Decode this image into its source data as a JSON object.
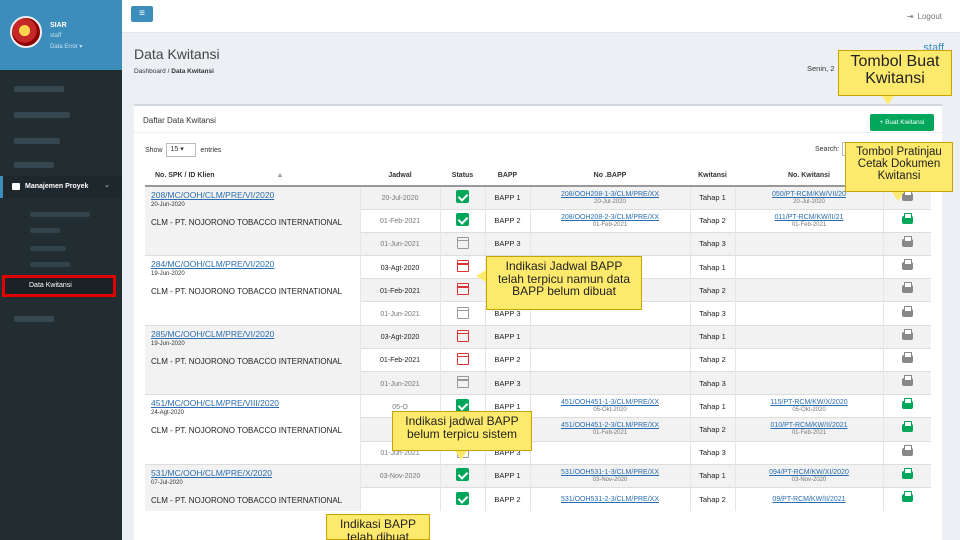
{
  "brand": {
    "name": "SIAR",
    "role": "staff",
    "menu": "Data Error ▾"
  },
  "sidebar": {
    "project_menu": "Manajemen Proyek",
    "active_item": "Data Kwitansi"
  },
  "topbar": {
    "menu_icon": "≡",
    "logout_icon": "⇥",
    "logout": "Logout"
  },
  "header": {
    "title": "Data Kwitansi",
    "breadcrumb_home": "Dashboard",
    "breadcrumb_sep": "/",
    "breadcrumb_current": "Data Kwitansi",
    "user": "staff",
    "date": "Senin, 2"
  },
  "box": {
    "title": "Daftar Data Kwitansi",
    "create_button": "+ Buat Kwitansi",
    "show_label": "Show",
    "show_value": "15 ▾",
    "entries_label": "entries",
    "search_label": "Search:"
  },
  "table": {
    "headers": [
      "No. SPK / ID Klien",
      "Jadwal",
      "Status",
      "BAPP",
      "No .BAPP",
      "Kwitansi",
      "No. Kwitansi",
      ""
    ],
    "sort_icon": "▲",
    "groups": [
      {
        "spk": "208/MC/OOH/CLM/PRE/VI/2020",
        "spk_date": "20-Jun-2020",
        "klien": "CLM - PT. NOJORONO TOBACCO INTERNATIONAL",
        "rows": [
          {
            "jadwal": "20-Jul-2020",
            "status": "ok",
            "bapp": "BAPP 1",
            "no_bapp": "208/OOH208-1-3/CLM/PRE/XX",
            "bapp_date": "20-Jul-2020",
            "kwitansi": "Tahap 1",
            "no_kw": "050/PT-RCM/KW/VII/20",
            "kw_date": "20-Jul-2020",
            "print": "grey"
          },
          {
            "jadwal": "01-Feb-2021",
            "status": "ok",
            "bapp": "BAPP 2",
            "no_bapp": "208/OOH208-2-3/CLM/PRE/XX",
            "bapp_date": "01-Feb-2021",
            "kwitansi": "Tahap 2",
            "no_kw": "011/PT-RCM/KW/II/21",
            "kw_date": "01-Feb-2021",
            "print": "green"
          },
          {
            "jadwal": "01-Jun-2021",
            "status": "cal-grey",
            "bapp": "BAPP 3",
            "no_bapp": "",
            "bapp_date": "",
            "kwitansi": "Tahap 3",
            "no_kw": "",
            "kw_date": "",
            "print": "grey"
          }
        ]
      },
      {
        "spk": "284/MC/OOH/CLM/PRE/VI/2020",
        "spk_date": "19-Jun-2020",
        "klien": "CLM - PT. NOJORONO TOBACCO INTERNATIONAL",
        "rows": [
          {
            "jadwal": "03-Agt-2020",
            "status": "cal-red",
            "bapp": "BAPP 1",
            "no_bapp": "",
            "bapp_date": "",
            "kwitansi": "Tahap 1",
            "no_kw": "",
            "kw_date": "",
            "print": "grey"
          },
          {
            "jadwal": "01-Feb-2021",
            "status": "cal-red",
            "bapp": "BAPP 2",
            "no_bapp": "",
            "bapp_date": "",
            "kwitansi": "Tahap 2",
            "no_kw": "",
            "kw_date": "",
            "print": "grey"
          },
          {
            "jadwal": "01-Jun-2021",
            "status": "cal-grey",
            "bapp": "BAPP 3",
            "no_bapp": "",
            "bapp_date": "",
            "kwitansi": "Tahap 3",
            "no_kw": "",
            "kw_date": "",
            "print": "grey"
          }
        ]
      },
      {
        "spk": "285/MC/OOH/CLM/PRE/VI/2020",
        "spk_date": "19-Jun-2020",
        "klien": "CLM - PT. NOJORONO TOBACCO INTERNATIONAL",
        "rows": [
          {
            "jadwal": "03-Agt-2020",
            "status": "cal-red",
            "bapp": "BAPP 1",
            "no_bapp": "",
            "bapp_date": "",
            "kwitansi": "Tahap 1",
            "no_kw": "",
            "kw_date": "",
            "print": "grey"
          },
          {
            "jadwal": "01-Feb-2021",
            "status": "cal-red",
            "bapp": "BAPP 2",
            "no_bapp": "",
            "bapp_date": "",
            "kwitansi": "Tahap 2",
            "no_kw": "",
            "kw_date": "",
            "print": "grey"
          },
          {
            "jadwal": "01-Jun-2021",
            "status": "cal-grey",
            "bapp": "BAPP 3",
            "no_bapp": "",
            "bapp_date": "",
            "kwitansi": "Tahap 3",
            "no_kw": "",
            "kw_date": "",
            "print": "grey"
          }
        ]
      },
      {
        "spk": "451/MC/OOH/CLM/PRE/VIII/2020",
        "spk_date": "24-Agt-2020",
        "klien": "CLM - PT. NOJORONO TOBACCO INTERNATIONAL",
        "rows": [
          {
            "jadwal": "05-O",
            "status": "ok",
            "bapp": "BAPP 1",
            "no_bapp": "451/OOH451-1-3/CLM/PRE/XX",
            "bapp_date": "05-Okt-2020",
            "kwitansi": "Tahap 1",
            "no_kw": "115/PT-RCM/KW/X/2020",
            "kw_date": "05-Okt-2020",
            "print": "green"
          },
          {
            "jadwal": "01-F",
            "status": "ok",
            "bapp": "BAPP 2",
            "no_bapp": "451/OOH451-2-3/CLM/PRE/XX",
            "bapp_date": "01-Feb-2021",
            "kwitansi": "Tahap 2",
            "no_kw": "010/PT-RCM/KW/II/2021",
            "kw_date": "01-Feb-2021",
            "print": "green"
          },
          {
            "jadwal": "01-Jun-2021",
            "status": "cal-grey",
            "bapp": "BAPP 3",
            "no_bapp": "",
            "bapp_date": "",
            "kwitansi": "Tahap 3",
            "no_kw": "",
            "kw_date": "",
            "print": "grey"
          }
        ]
      },
      {
        "spk": "531/MC/OOH/CLM/PRE/X/2020",
        "spk_date": "07-Jul-2020",
        "klien": "CLM - PT. NOJORONO TOBACCO INTERNATIONAL",
        "rows": [
          {
            "jadwal": "03-Nov-2020",
            "status": "ok",
            "bapp": "BAPP 1",
            "no_bapp": "531/OOH531-1-3/CLM/PRE/XX",
            "bapp_date": "03-Nov-2020",
            "kwitansi": "Tahap 1",
            "no_kw": "094/PT-RCM/KW/XI/2020",
            "kw_date": "03-Nov-2020",
            "print": "green"
          },
          {
            "jadwal": "",
            "status": "ok",
            "bapp": "BAPP 2",
            "no_bapp": "531/OOH531-2-3/CLM/PRE/XX",
            "bapp_date": "",
            "kwitansi": "Tahap 2",
            "no_kw": "09/PT-RCM/KW/II/2021",
            "kw_date": "",
            "print": "green"
          }
        ]
      }
    ]
  },
  "callouts": {
    "create": "Tombol Buat Kwitansi",
    "preview": "Tombol Pratinjau Cetak Dokumen Kwitansi",
    "triggered": "Indikasi Jadwal BAPP telah terpicu namun data BAPP belum dibuat",
    "not_triggered": "Indikasi jadwal BAPP belum terpicu sistem",
    "created": "Indikasi BAPP telah dibuat"
  }
}
